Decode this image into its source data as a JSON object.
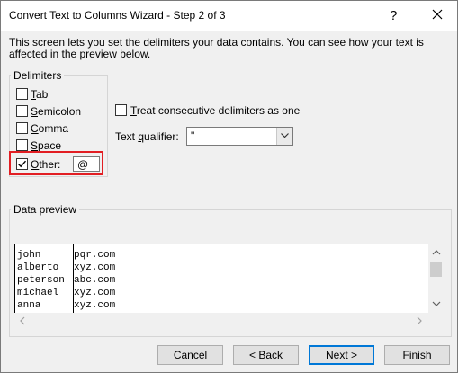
{
  "dialog": {
    "title": "Convert Text to Columns Wizard - Step 2 of 3",
    "help_label": "?",
    "description": "This screen lets you set the delimiters your data contains.  You can see how your text is affected in the preview below."
  },
  "delimiters": {
    "legend": "Delimiters",
    "items": [
      {
        "key": "T",
        "rest": "ab",
        "checked": false
      },
      {
        "key": "S",
        "rest": "emicolon",
        "checked": false
      },
      {
        "key": "C",
        "rest": "omma",
        "checked": false
      },
      {
        "key": "S",
        "rest": "pace",
        "checked": false
      },
      {
        "key": "O",
        "rest": "ther:",
        "checked": true
      }
    ],
    "other_value": "@"
  },
  "consecutive": {
    "pre": "",
    "key": "T",
    "rest": "reat consecutive delimiters as one",
    "checked": false
  },
  "qualifier": {
    "pre": "Text ",
    "key": "q",
    "rest": "ualifier:",
    "value": "\""
  },
  "preview": {
    "legend": "Data preview",
    "rows": [
      [
        "john",
        "pqr.com"
      ],
      [
        "alberto",
        "xyz.com"
      ],
      [
        "peterson",
        "abc.com"
      ],
      [
        "michael",
        "xyz.com"
      ],
      [
        "anna",
        "xyz.com"
      ]
    ]
  },
  "buttons": {
    "cancel": {
      "label": "Cancel"
    },
    "back": {
      "pre": "< ",
      "key": "B",
      "rest": "ack"
    },
    "next": {
      "key": "N",
      "rest": "ext >"
    },
    "finish": {
      "key": "F",
      "rest": "inish"
    }
  }
}
